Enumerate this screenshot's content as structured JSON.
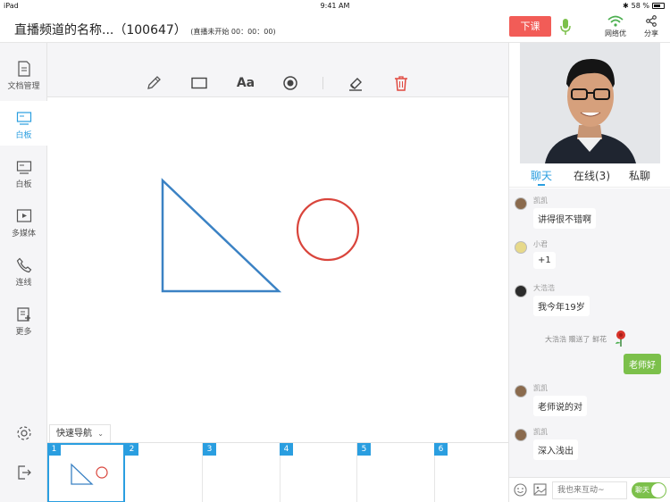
{
  "status": {
    "device": "iPad",
    "time": "9:41 AM",
    "battery": "58 %"
  },
  "header": {
    "title": "直播频道的名称...（100647）",
    "live_status": "(直播未开始 00：00：00)",
    "end_button": "下课",
    "network_label": "网络优",
    "share_label": "分享"
  },
  "sidebar": {
    "items": [
      {
        "label": "文档管理",
        "icon": "document-icon"
      },
      {
        "label": "白板",
        "icon": "whiteboard-icon"
      },
      {
        "label": "白板",
        "icon": "whiteboard-icon"
      },
      {
        "label": "多媒体",
        "icon": "media-icon"
      },
      {
        "label": "连线",
        "icon": "phone-icon"
      },
      {
        "label": "更多",
        "icon": "more-icon"
      }
    ],
    "active_index": 1
  },
  "toolbar": {
    "tools": [
      "pencil-icon",
      "rectangle-icon",
      "text-icon",
      "circle-icon",
      "eraser-icon",
      "trash-icon"
    ],
    "text_tool_label": "Aa"
  },
  "quicknav": {
    "label": "快速导航"
  },
  "pages": [
    "1",
    "2",
    "3",
    "4",
    "5",
    "6"
  ],
  "chat": {
    "tabs": [
      "聊天",
      "在线(3)",
      "私聊"
    ],
    "messages": [
      {
        "name": "凯凯",
        "text": "讲得很不错啊"
      },
      {
        "name": "小君",
        "text": "+1"
      },
      {
        "name": "大浩浩",
        "text": "我今年19岁"
      }
    ],
    "gift": "大浩浩 赠送了 鲜花",
    "my_message": "老师好",
    "messages2": [
      {
        "name": "凯凯",
        "text": "老师说的对"
      },
      {
        "name": "凯凯",
        "text": "深入浅出"
      }
    ],
    "input_placeholder": "我也来互动~",
    "toggle_label": "聊天"
  },
  "colors": {
    "accent": "#2a9ee0",
    "danger": "#f25c57",
    "green": "#7cc04b",
    "shape_blue": "#3b82c4",
    "shape_red": "#d9453c"
  }
}
